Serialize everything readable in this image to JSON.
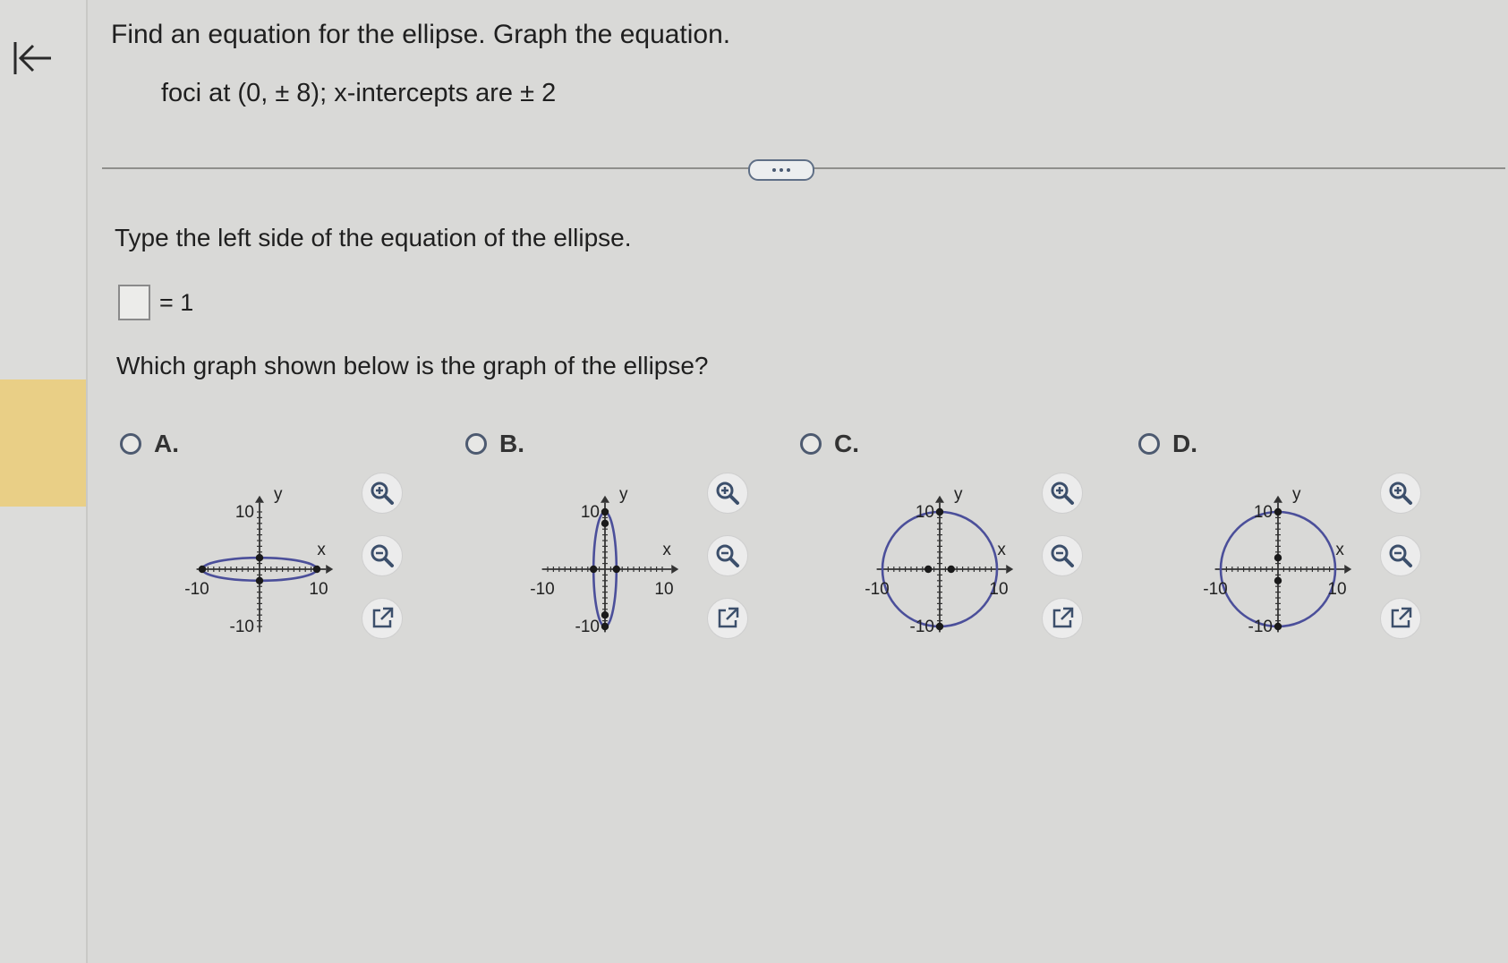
{
  "question": {
    "title": "Find an equation for the ellipse. Graph the equation.",
    "given": "foci at (0, ± 8); x-intercepts are ± 2"
  },
  "part1": {
    "instruction": "Type the left side of the equation of the ellipse.",
    "answer_value": "",
    "answer_rhs": "= 1"
  },
  "part2": {
    "question": "Which graph shown below is the graph of the ellipse?"
  },
  "options": [
    {
      "label": "A.",
      "rx": 10,
      "ry": 2,
      "points": [
        [
          0,
          2
        ],
        [
          0,
          -2
        ],
        [
          -10,
          0
        ],
        [
          10,
          0
        ]
      ]
    },
    {
      "label": "B.",
      "rx": 2,
      "ry": 10,
      "points": [
        [
          0,
          10
        ],
        [
          0,
          -10
        ],
        [
          0,
          8
        ],
        [
          0,
          -8
        ],
        [
          -2,
          0
        ],
        [
          2,
          0
        ]
      ]
    },
    {
      "label": "C.",
      "rx": 10,
      "ry": 10,
      "points": [
        [
          0,
          10
        ],
        [
          0,
          -10
        ],
        [
          -2,
          0
        ],
        [
          2,
          0
        ]
      ]
    },
    {
      "label": "D.",
      "rx": 10,
      "ry": 10,
      "points": [
        [
          0,
          10
        ],
        [
          0,
          -10
        ],
        [
          0,
          2
        ],
        [
          0,
          -2
        ]
      ]
    }
  ],
  "graph_labels": {
    "y_top": "10",
    "y_bottom": "-10",
    "x_left": "-10",
    "x_right": "10",
    "x_axis": "x",
    "y_axis": "y"
  },
  "colors": {
    "ellipse": "#4b4f9a",
    "accent_highlight": "#e9cf86",
    "icon": "#3c4f6b"
  },
  "icons": [
    "back-arrow-icon",
    "zoom-in-icon",
    "zoom-out-icon",
    "external-link-icon",
    "more-dots-icon"
  ]
}
